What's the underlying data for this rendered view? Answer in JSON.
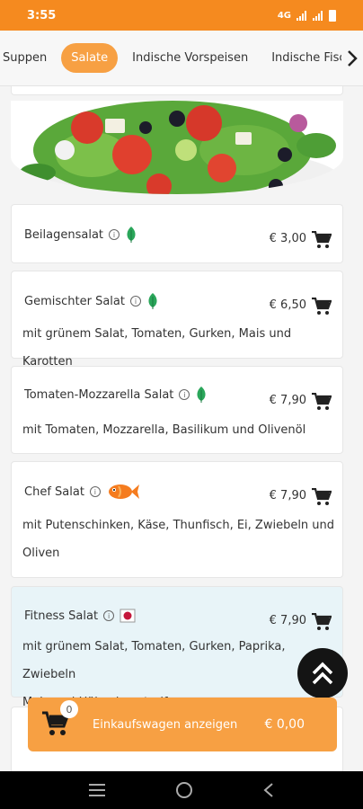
{
  "status": {
    "time": "3:55",
    "network": "4G"
  },
  "tabs": [
    {
      "label": "Suppen",
      "active": false
    },
    {
      "label": "Salate",
      "active": true
    },
    {
      "label": "Indische Vorspeisen",
      "active": false
    },
    {
      "label": "Indische Fisch",
      "active": false
    }
  ],
  "items": [
    {
      "name": "Beilagensalat",
      "price": "€ 3,00",
      "icon": "leaf-icon",
      "desc": []
    },
    {
      "name": "Gemischter Salat",
      "price": "€ 6,50",
      "icon": "leaf-icon",
      "desc": [
        "mit grünem Salat, Tomaten, Gurken, Mais und Karotten"
      ]
    },
    {
      "name": "Tomaten-Mozzarella Salat",
      "price": "€ 7,90",
      "icon": "leaf-icon",
      "desc": [
        "mit Tomaten, Mozzarella, Basilikum und Olivenöl"
      ]
    },
    {
      "name": "Chef Salat",
      "price": "€ 7,90",
      "icon": "fish-icon",
      "desc": [
        "mit Putenschinken, Käse, Thunfisch, Ei, Zwiebeln und",
        "Oliven"
      ]
    },
    {
      "name": "Fitness Salat",
      "price": "€ 7,90",
      "icon": "meat-icon",
      "desc": [
        "mit grünem Salat, Tomaten, Gurken, Paprika, Zwiebeln",
        "Mais und Hähnchenstreifen"
      ]
    }
  ],
  "cart": {
    "count": "0",
    "label": "Einkaufswagen anzeigen",
    "total": "€ 0,00"
  },
  "colors": {
    "accent": "#f58a1f",
    "tab_active": "#f7a043",
    "highlight": "#e8f4f8"
  }
}
